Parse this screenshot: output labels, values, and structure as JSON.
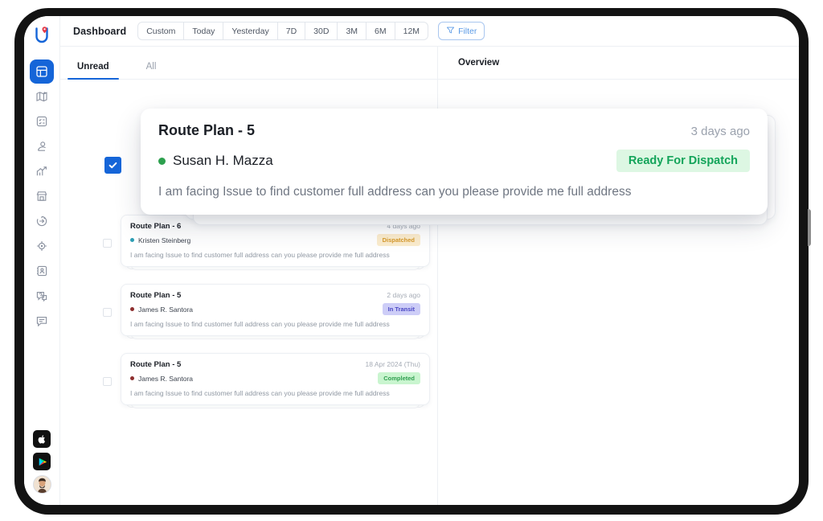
{
  "sidebar": {
    "logo": "uffizzi-logo-icon",
    "items": [
      {
        "name": "dashboard",
        "icon": "dashboard-icon",
        "active": true
      },
      {
        "name": "map",
        "icon": "map-icon",
        "active": false
      },
      {
        "name": "tasks",
        "icon": "task-list-icon",
        "active": false
      },
      {
        "name": "drivers",
        "icon": "user-icon",
        "active": false
      },
      {
        "name": "analytics",
        "icon": "analytics-chart-icon",
        "active": false
      },
      {
        "name": "store",
        "icon": "store-icon",
        "active": false
      },
      {
        "name": "dispatch",
        "icon": "dispatch-gear-icon",
        "active": false
      },
      {
        "name": "tracking",
        "icon": "target-crosshair-icon",
        "active": false
      },
      {
        "name": "contacts",
        "icon": "contact-card-icon",
        "active": false
      },
      {
        "name": "support",
        "icon": "help-chat-icon",
        "active": false
      },
      {
        "name": "messages",
        "icon": "message-icon",
        "active": false
      }
    ],
    "app_store_badge": "apple-appstore-icon",
    "play_store_badge": "google-play-icon",
    "avatar": "user-avatar"
  },
  "topbar": {
    "title": "Dashboard",
    "ranges": [
      "Custom",
      "Today",
      "Yesterday",
      "7D",
      "30D",
      "3M",
      "6M",
      "12M"
    ],
    "filter_label": "Filter",
    "filter_icon": "funnel-icon"
  },
  "tabs": [
    {
      "label": "Unread",
      "active": true
    },
    {
      "label": "All",
      "active": false
    }
  ],
  "overview": {
    "title": "Overview"
  },
  "popup": {
    "title": "Route Plan - 5",
    "time": "3 days ago",
    "name": "Susan H. Mazza",
    "dot_color": "#2da04e",
    "badge": "Ready For Dispatch",
    "badge_bg": "#ddf7e3",
    "badge_color": "#13a45a",
    "message": "I am facing Issue to find customer full address can you please provide me full address",
    "checked": true
  },
  "cards": [
    {
      "title": "Route Plan - 6",
      "time": "4 days ago",
      "name": "Kristen Steinberg",
      "dot_color": "#2f9fb5",
      "badge": "Dispatched",
      "badge_bg": "#fbeccd",
      "badge_color": "#d79a2b",
      "message": "I am facing Issue to find customer full address can you please provide me full address"
    },
    {
      "title": "Route Plan - 5",
      "time": "2 days ago",
      "name": "James R. Santora",
      "dot_color": "#8e2f2f",
      "badge": "In Transit",
      "badge_bg": "#cdcdf7",
      "badge_color": "#4a47c4",
      "message": "I am facing Issue to find customer full address can you please provide me full address"
    },
    {
      "title": "Route Plan - 5",
      "time": "18 Apr 2024 (Thu)",
      "name": "James R. Santora",
      "dot_color": "#8e2f2f",
      "badge": "Completed",
      "badge_bg": "#c9f5cf",
      "badge_color": "#2f9e4f",
      "message": "I am facing Issue to find customer full address can you please provide me full address"
    }
  ],
  "colors": {
    "accent": "#1565d8",
    "bezel": "#131313"
  }
}
